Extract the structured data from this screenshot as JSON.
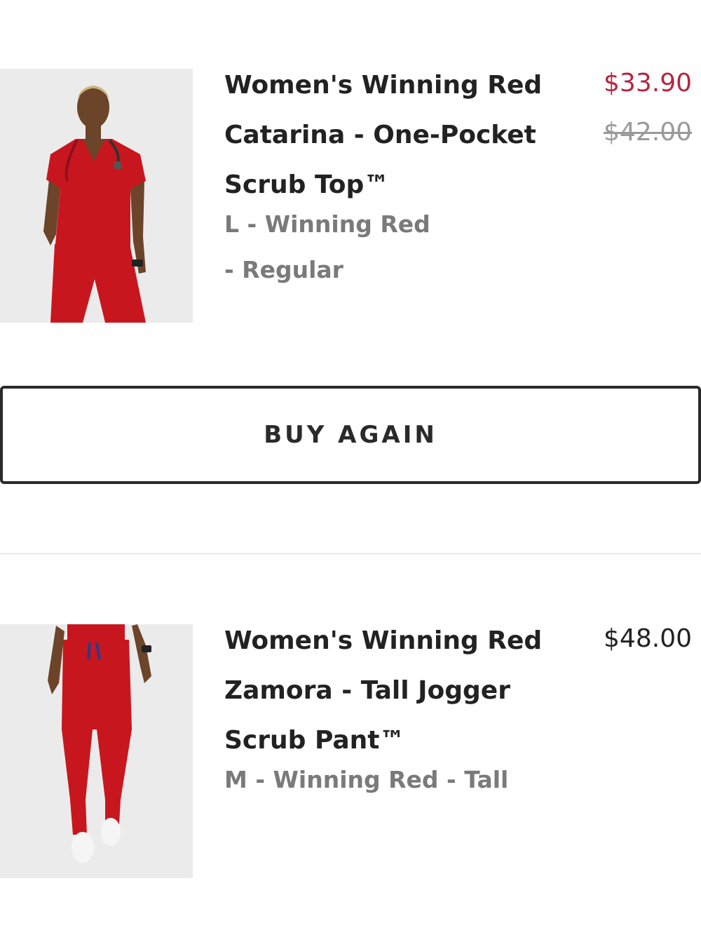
{
  "order_items": [
    {
      "title_lines": [
        "Women's Winning Red",
        "Catarina - One-Pocket",
        "Scrub Top™"
      ],
      "variant_lines": [
        "L - Winning Red",
        "- Regular"
      ],
      "price_sale": "$33.90",
      "price_original": "$42.00",
      "image_icon": "product-photo-scrub-top"
    },
    {
      "title_lines": [
        "Women's Winning Red",
        "Zamora - Tall Jogger",
        "Scrub Pant™"
      ],
      "variant_lines": [
        "M - Winning Red - Tall"
      ],
      "price": "$48.00",
      "image_icon": "product-photo-jogger-pant"
    }
  ],
  "buy_again": {
    "label": "BUY AGAIN"
  },
  "colors": {
    "sale_price": "#b5263f",
    "original_price": "#9a9a9a",
    "text_primary": "#222222",
    "text_secondary": "#7a7a7a",
    "product_red": "#c8161e",
    "image_background": "#ebebeb"
  }
}
